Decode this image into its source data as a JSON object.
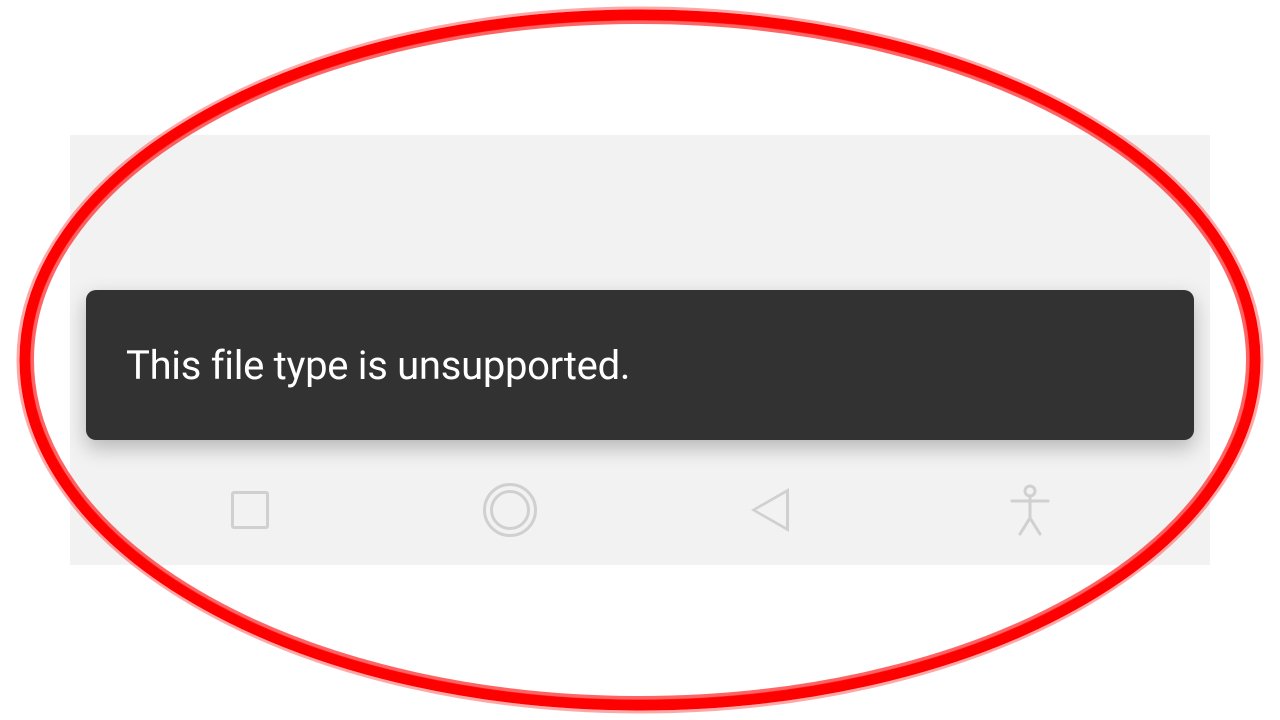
{
  "toast": {
    "message": "This file type is unsupported."
  },
  "annotation": {
    "stroke_color": "#ff0000"
  },
  "nav": {
    "recent": "recent-apps",
    "home": "home",
    "back": "back",
    "accessibility": "accessibility"
  }
}
